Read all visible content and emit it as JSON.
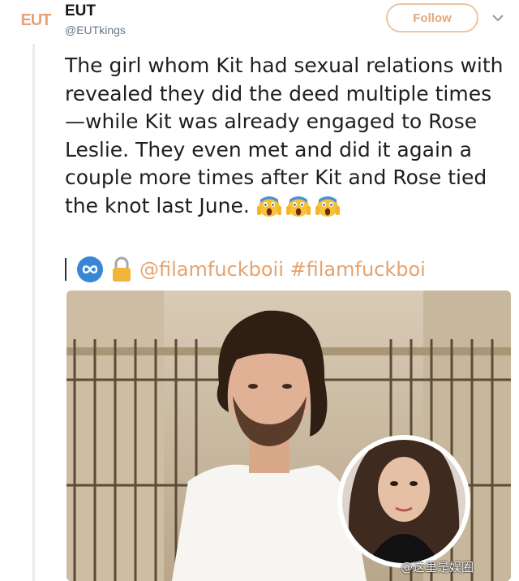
{
  "tweet": {
    "avatar_text": "EUT",
    "display_name": "EUT",
    "handle": "@EUTkings",
    "follow_label": "Follow",
    "text": "The girl whom Kit had sexual relations with revealed they did the deed multiple times—while Kit was already engaged to Rose Leslie. They even met and did it again a couple more times after Kit and Rose tied the knot last June.",
    "emoji": [
      "screaming-face",
      "screaming-face",
      "screaming-face"
    ],
    "link_text": "@filamfuckboii #filamfuckboi",
    "link_icons": [
      "infinity-icon",
      "lock-icon"
    ]
  },
  "media": {
    "watermark": "@这里是娱圈"
  },
  "colors": {
    "accent": "#e4a36f",
    "follow_border": "#e9c6a4",
    "thread_line": "#e6ecf0"
  }
}
